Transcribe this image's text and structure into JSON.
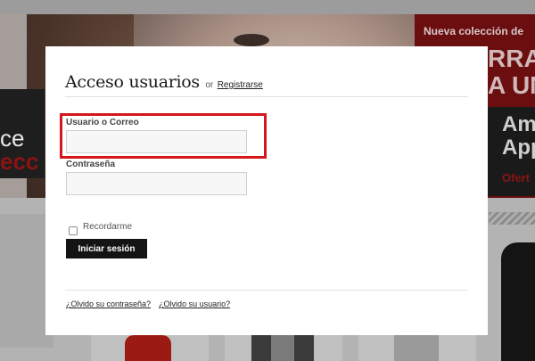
{
  "background": {
    "left_banner_text_white": "ce",
    "left_banner_text_red": "ecc",
    "promo_line": "Nueva colección de",
    "promo_big_lines": [
      "RRA",
      "A UN"
    ],
    "promo_am_lines": [
      "Am",
      "App"
    ],
    "promo_offer": "Ofert"
  },
  "modal": {
    "title": "Acceso usuarios",
    "or_text": "or",
    "register_link": "Registrarse",
    "username": {
      "label": "Usuario o Correo",
      "value": "",
      "placeholder": ""
    },
    "password": {
      "label": "Contraseña",
      "value": "",
      "placeholder": ""
    },
    "remember": {
      "label": "Recordarme",
      "checked": false
    },
    "submit_label": "Iniciar sesión",
    "forgot_password": "¿Olvido su contraseña?",
    "forgot_user": "¿Olvido su usuario?"
  },
  "annotation": {
    "highlight_color": "#d3171c",
    "highlighted_field": "username"
  },
  "colors": {
    "button_bg": "#141414",
    "overlay_dim": "#9a9a9a"
  }
}
